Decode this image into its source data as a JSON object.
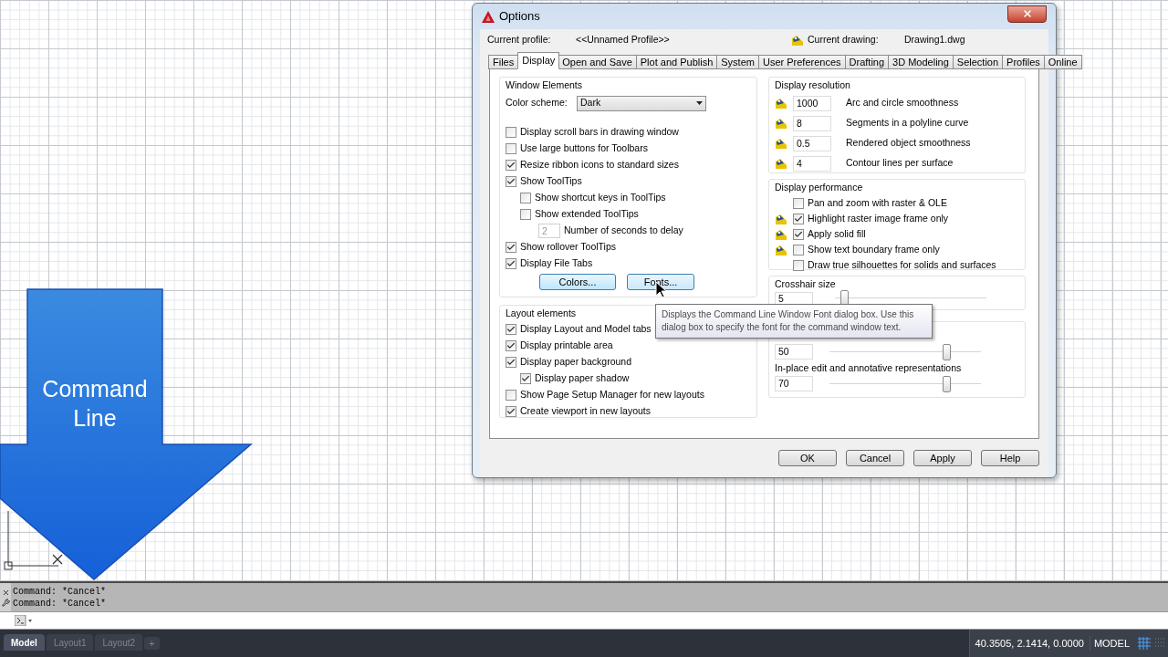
{
  "dialog": {
    "title": "Options",
    "profile": {
      "label": "Current profile:",
      "value": "<<Unnamed Profile>>"
    },
    "drawing": {
      "label": "Current drawing:",
      "value": "Drawing1.dwg"
    },
    "tabs": [
      {
        "label": "Files",
        "selected": false
      },
      {
        "label": "Display",
        "selected": true
      },
      {
        "label": "Open and Save",
        "selected": false
      },
      {
        "label": "Plot and Publish",
        "selected": false
      },
      {
        "label": "System",
        "selected": false
      },
      {
        "label": "User Preferences",
        "selected": false
      },
      {
        "label": "Drafting",
        "selected": false
      },
      {
        "label": "3D Modeling",
        "selected": false
      },
      {
        "label": "Selection",
        "selected": false
      },
      {
        "label": "Profiles",
        "selected": false
      },
      {
        "label": "Online",
        "selected": false
      }
    ],
    "window_elements": {
      "title": "Window Elements",
      "color_scheme": {
        "label": "Color scheme:",
        "value": "Dark"
      },
      "options": [
        {
          "kind": "checkbox",
          "label": "Display scroll bars in drawing window",
          "checked": false
        },
        {
          "kind": "checkbox",
          "label": "Use large buttons for Toolbars",
          "checked": false
        },
        {
          "kind": "checkbox",
          "label": "Resize ribbon icons to standard sizes",
          "checked": true
        },
        {
          "kind": "checkbox",
          "label": "Show ToolTips",
          "checked": true,
          "children": [
            {
              "kind": "checkbox",
              "label": "Show shortcut keys in ToolTips",
              "checked": false
            },
            {
              "kind": "checkbox",
              "label": "Show extended ToolTips",
              "checked": false,
              "children": [
                {
                  "kind": "number",
                  "value": "2",
                  "label": "Number of seconds to delay",
                  "disabled": true
                }
              ]
            }
          ]
        },
        {
          "kind": "checkbox",
          "label": "Show rollover ToolTips",
          "checked": true
        },
        {
          "kind": "checkbox",
          "label": "Display File Tabs",
          "checked": true
        }
      ],
      "buttons": [
        "Colors...",
        "Fonts..."
      ]
    },
    "layout_elements": {
      "title": "Layout elements",
      "options": [
        {
          "kind": "checkbox",
          "label": "Display Layout and Model tabs",
          "checked": true
        },
        {
          "kind": "checkbox",
          "label": "Display printable area",
          "checked": true
        },
        {
          "kind": "checkbox",
          "label": "Display paper background",
          "checked": true,
          "children": [
            {
              "kind": "checkbox",
              "label": "Display paper shadow",
              "checked": true
            }
          ]
        },
        {
          "kind": "checkbox",
          "label": "Show Page Setup Manager for new layouts",
          "checked": false
        },
        {
          "kind": "checkbox",
          "label": "Create viewport in new layouts",
          "checked": true
        }
      ]
    },
    "display_resolution": {
      "title": "Display resolution",
      "rows": [
        {
          "value": "1000",
          "label": "Arc and circle smoothness",
          "in_drawing": true
        },
        {
          "value": "8",
          "label": "Segments in a polyline curve",
          "in_drawing": true
        },
        {
          "value": "0.5",
          "label": "Rendered object smoothness",
          "in_drawing": true
        },
        {
          "value": "4",
          "label": "Contour lines per surface",
          "in_drawing": true
        }
      ]
    },
    "display_performance": {
      "title": "Display performance",
      "rows": [
        {
          "label": "Pan and zoom with raster & OLE",
          "checked": false,
          "in_drawing": false
        },
        {
          "label": "Highlight raster image frame only",
          "checked": true,
          "in_drawing": true
        },
        {
          "label": "Apply solid fill",
          "checked": true,
          "in_drawing": true
        },
        {
          "label": "Show text boundary frame only",
          "checked": false,
          "in_drawing": true
        },
        {
          "label": "Draw true silhouettes for solids and surfaces",
          "checked": false,
          "in_drawing": false
        }
      ]
    },
    "crosshair": {
      "title": "Crosshair size",
      "value": "5",
      "level": 0.06
    },
    "fade": {
      "rows": [
        {
          "value": "50",
          "level": 0.77
        },
        {
          "label": "In-place edit and annotative representations",
          "value": "70",
          "level": 0.77
        }
      ]
    },
    "buttons": [
      "OK",
      "Cancel",
      "Apply",
      "Help"
    ]
  },
  "tooltip": {
    "text": "Displays the Command Line Window Font dialog box. Use this dialog box to specify the font for the command window text."
  },
  "callout": {
    "text": "Command Line"
  },
  "command_history": [
    "Command: *Cancel*",
    "Command: *Cancel*"
  ],
  "layout_tabs": [
    {
      "label": "Model",
      "selected": true
    },
    {
      "label": "Layout1",
      "selected": false
    },
    {
      "label": "Layout2",
      "selected": false
    }
  ],
  "add_tab": "+",
  "status_bar": {
    "coordinates": "40.3505, 2.1414, 0.0000",
    "space": "MODEL"
  }
}
